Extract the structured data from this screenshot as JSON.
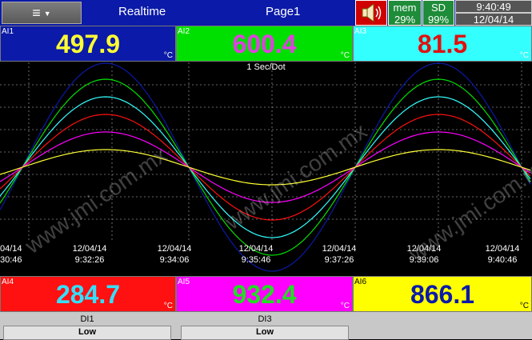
{
  "header": {
    "menu_icon": "hamburger-menu-icon",
    "title": "Realtime",
    "page": "Page1",
    "alarm_icon": "speaker-icon",
    "mem": {
      "label": "mem",
      "value": "29%"
    },
    "sd": {
      "label": "SD",
      "value": "99%"
    },
    "time": "9:40:49",
    "date": "12/04/14"
  },
  "channels_top": [
    {
      "label": "AI1",
      "value": "497.9",
      "unit": "°C",
      "bg": "#0b1aa8",
      "fg": "#ffff33"
    },
    {
      "label": "AI2",
      "value": "600.4",
      "unit": "°C",
      "bg": "#00e000",
      "fg": "#e040e0"
    },
    {
      "label": "AI3",
      "value": "81.5",
      "unit": "°C",
      "bg": "#33ffff",
      "fg": "#e01010"
    }
  ],
  "channels_bottom": [
    {
      "label": "AI4",
      "value": "284.7",
      "unit": "°C",
      "bg": "#ff1111",
      "fg": "#33e0ff"
    },
    {
      "label": "AI5",
      "value": "932.4",
      "unit": "°C",
      "bg": "#ff00ff",
      "fg": "#22dd22"
    },
    {
      "label": "AI6",
      "value": "866.1",
      "unit": "°C",
      "bg": "#ffff00",
      "fg": "#0b1aa8"
    }
  ],
  "chart": {
    "speed_label": "1 Sec/Dot",
    "watermark": "www.jmi.com.mx",
    "time_ticks": [
      {
        "date": "04/14",
        "time": "30:46"
      },
      {
        "date": "12/04/14",
        "time": "9:32:26"
      },
      {
        "date": "12/04/14",
        "time": "9:34:06"
      },
      {
        "date": "12/04/14",
        "time": "9:35:46"
      },
      {
        "date": "12/04/14",
        "time": "9:37:26"
      },
      {
        "date": "12/04/14",
        "time": "9:39:06"
      },
      {
        "date": "12/04/14",
        "time": "9:40:46"
      }
    ],
    "trace_colors": [
      "#0b1aa8",
      "#00e000",
      "#33ffff",
      "#ff1111",
      "#ff00ff",
      "#ffff33"
    ]
  },
  "digital_inputs": [
    {
      "label": "DI1",
      "value": "Low"
    },
    {
      "label": "DI3",
      "value": "Low"
    }
  ]
}
